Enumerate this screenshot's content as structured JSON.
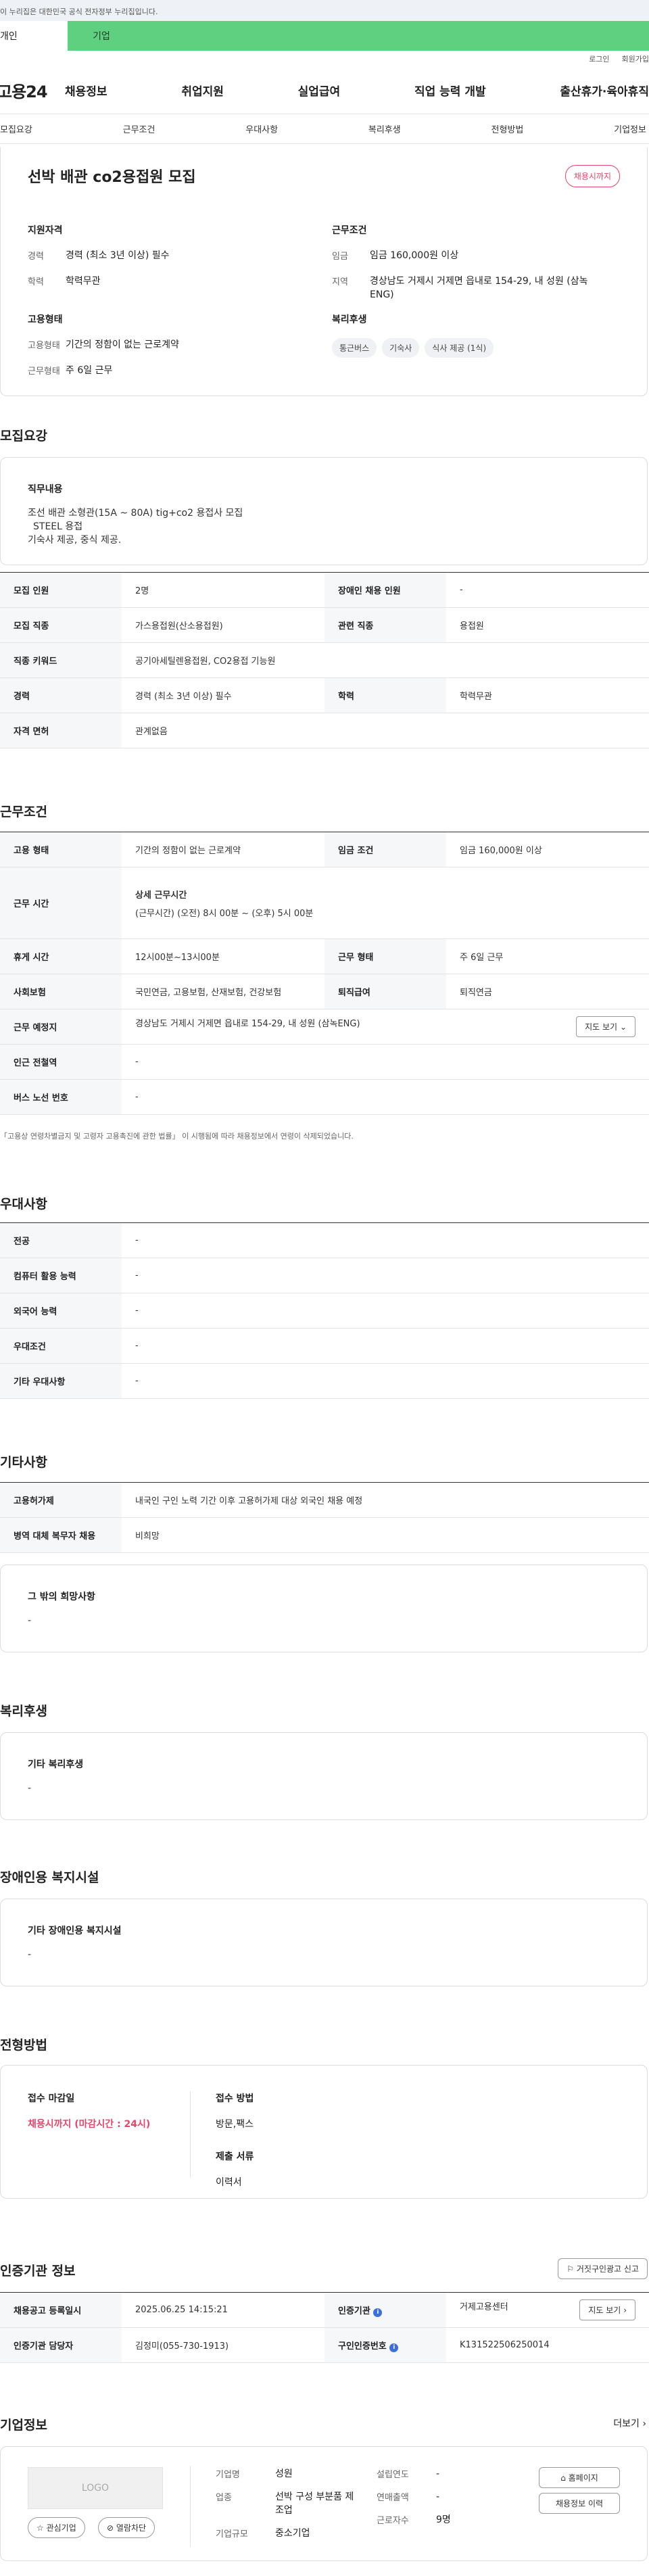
{
  "banner": "이 누리집은 대한민국 공식 전자정부 누리집입니다.",
  "usertabs": [
    "개인",
    "기업"
  ],
  "util": [
    "로그인",
    "회원가입"
  ],
  "logo": "고용24",
  "gnb": [
    "채용정보",
    "취업지원",
    "실업급여",
    "직업 능력 개발",
    "출산휴가·육아휴직"
  ],
  "subnav": [
    "모집요강",
    "근무조건",
    "우대사항",
    "복리후생",
    "전형방법",
    "기업정보"
  ],
  "top": {
    "title": "선박 배관 co2용접원 모집",
    "badge": "채용시까지",
    "req_title": "지원자격",
    "req": [
      {
        "k": "경력",
        "v": "경력 (최소 3년 이상) 필수"
      },
      {
        "k": "학력",
        "v": "학력무관"
      }
    ],
    "emp_title": "고용형태",
    "emp": [
      {
        "k": "고용형태",
        "v": "기간의 정함이 없는 근로계약"
      },
      {
        "k": "근무형태",
        "v": "주 6일 근무"
      }
    ],
    "cond_title": "근무조건",
    "cond": [
      {
        "k": "임금",
        "v": "임금 160,000원 이상"
      },
      {
        "k": "지역",
        "v": "경상남도 거제시 거제면 읍내로 154-29, 내 성원 (삼녹 ENG)"
      }
    ],
    "welf_title": "복리후생",
    "welf": [
      "통근버스",
      "기숙사",
      "식사 제공 (1식)"
    ]
  },
  "recruit": {
    "title": "모집요강",
    "duty_title": "직무내용",
    "duty": [
      "조선 배관 소형관(15A ~ 80A) tig+co2 용접사 모집",
      "STEEL 용접",
      "기숙사 제공, 중식 제공."
    ],
    "rows": [
      [
        {
          "h": "모집 인원",
          "v": "2명"
        },
        {
          "h": "장애인 채용 인원",
          "v": "-"
        }
      ],
      [
        {
          "h": "모집 직종",
          "v": "가스용접원(산소용접원)"
        },
        {
          "h": "관련 직종",
          "v": "용접원"
        }
      ],
      [
        {
          "h": "직종 키워드",
          "v": "공기아세틸렌용접원, CO2용접 기능원"
        }
      ],
      [
        {
          "h": "경력",
          "v": "경력 (최소 3년 이상) 필수"
        },
        {
          "h": "학력",
          "v": "학력무관"
        }
      ],
      [
        {
          "h": "자격 면허",
          "v": "관계없음"
        }
      ]
    ]
  },
  "work": {
    "title": "근무조건",
    "wage_h": "고용 형태",
    "wage_v": "기간의 정함이 없는 근로계약",
    "pay_h": "임금 조건",
    "pay_v": "임금 160,000원 이상",
    "time_h": "근무 시간",
    "time_sub": "상세 근무시간",
    "time_v": "(근무시간) (오전) 8시 00분 ~ (오후) 5시 00분",
    "rest_h": "휴게 시간",
    "rest_v": "12시00분~13시00분",
    "type_h": "근무 형태",
    "type_v": "주 6일 근무",
    "ins_h": "사회보험",
    "ins_v": "국민연금, 고용보험, 산재보험, 건강보험",
    "ret_h": "퇴직급여",
    "ret_v": "퇴직연금",
    "place_h": "근무 예정지",
    "place_v": "경상남도 거제시 거제면 읍내로 154-29, 내 성원 (삼녹ENG)",
    "map_btn": "지도 보기",
    "sub_h": "인근 전철역",
    "sub_v": "-",
    "bus_h": "버스 노선 번호",
    "bus_v": "-",
    "note": "「고용상 연령차별금지 및 고령자 고용촉진에 관한 법률」 이 시행됨에 따라 채용정보에서 연령이 삭제되었습니다."
  },
  "pref": {
    "title": "우대사항",
    "rows": [
      {
        "h": "전공",
        "v": "-"
      },
      {
        "h": "컴퓨터 활용 능력",
        "v": "-"
      },
      {
        "h": "외국어 능력",
        "v": "-"
      },
      {
        "h": "우대조건",
        "v": "-"
      },
      {
        "h": "기타 우대사항",
        "v": "-"
      }
    ]
  },
  "etc": {
    "title": "기타사항",
    "rows": [
      {
        "h": "고용허가제",
        "v": "내국인 구인 노력 기간 이후 고용허가제 대상 외국인 채용 예정"
      },
      {
        "h": "병역 대체 복무자 채용",
        "v": "비희망"
      }
    ],
    "box_title": "그 밖의 희망사항",
    "box_v": "-"
  },
  "welfare": {
    "title": "복리후생",
    "box_title": "기타 복리후생",
    "box_v": "-"
  },
  "disab": {
    "title": "장애인용 복지시설",
    "box_title": "기타 장애인용 복지시설",
    "box_v": "-"
  },
  "select": {
    "title": "전형방법",
    "deadline_t": "접수 마감일",
    "deadline_v": "채용시까지 (마감시간 : 24시)",
    "method_t": "접수 방법",
    "method_v": "방문,팩스",
    "docs_t": "제출 서류",
    "docs_v": "이력서"
  },
  "cert": {
    "title": "인증기관 정보",
    "report_btn": "거짓구인광고 신고",
    "reg_h": "채용공고 등록일시",
    "reg_v": "2025.06.25 14:15:21",
    "org_h": "인증기관",
    "org_v": "거제고용센터",
    "map_btn": "지도 보기",
    "mgr_h": "인증기관 담당자",
    "mgr_v": "김정미(055-730-1913)",
    "no_h": "구인인증번호",
    "no_v": "K131522506250014"
  },
  "company": {
    "title": "기업정보",
    "more": "더보기",
    "logo": "LOGO",
    "fav": "관심기업",
    "block": "열람차단",
    "f": [
      {
        "k": "기업명",
        "v": "성원"
      },
      {
        "k": "업종",
        "v": "선박 구성 부분품 제조업"
      },
      {
        "k": "기업규모",
        "v": "중소기업"
      }
    ],
    "g": [
      {
        "k": "설립연도",
        "v": "-"
      },
      {
        "k": "연매출액",
        "v": "-"
      },
      {
        "k": "근로자수",
        "v": "9명"
      }
    ],
    "home_btn": "홈페이지",
    "hist_btn": "채용정보 이력"
  }
}
